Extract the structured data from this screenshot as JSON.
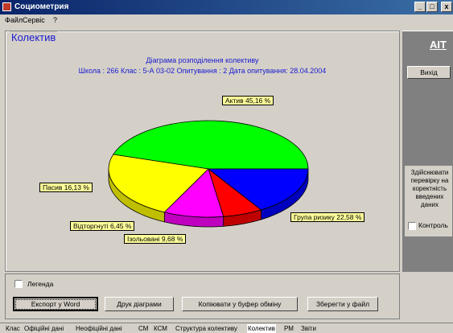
{
  "window": {
    "title": "Социометрия",
    "controls": [
      "_",
      "□",
      "x"
    ]
  },
  "menu": [
    "Файл",
    "Сервіс",
    "?"
  ],
  "panel": {
    "title": "Колектив",
    "heading1": "Діаграма розподілення колективу",
    "heading2": "Школа :  266  Клас :  5-А 03-02  Опитування  :  2  Дата опитування:  28.04.2004"
  },
  "chart_data": {
    "type": "pie",
    "title": "Діаграма розподілення колективу",
    "slices": [
      {
        "label": "Актив 45,16 %",
        "value": 45.16,
        "color": "#00ff00"
      },
      {
        "label": "Група ризику 22,58 %",
        "value": 22.58,
        "color": "#ffff00"
      },
      {
        "label": "Ізольовані 9,68 %",
        "value": 9.68,
        "color": "#ff00ff"
      },
      {
        "label": "Відторгнуті 6,45 %",
        "value": 6.45,
        "color": "#ff0000"
      },
      {
        "label": "Пасив 16,13 %",
        "value": 16.13,
        "color": "#0000ff"
      }
    ]
  },
  "sidebar": {
    "logo": "AIT",
    "exit_label": "Вихід",
    "check_text": "Здійснювати перевірку на коректність введених даних",
    "control_label": "Контроль"
  },
  "legend_label": "Легенда",
  "buttons": {
    "export_word": "Експорт у Word",
    "print_chart": "Друк діаграми",
    "copy_clipboard": "Копіювати у буфер обміну",
    "save_file": "Зберегти у файл"
  },
  "tabs": [
    "Клас",
    "Офіційні дані",
    "Неофіційні дані",
    "СМ",
    "КСМ",
    "Структура колективу",
    "Колектив",
    "РМ",
    "Звіти"
  ],
  "active_tab": "Колектив"
}
